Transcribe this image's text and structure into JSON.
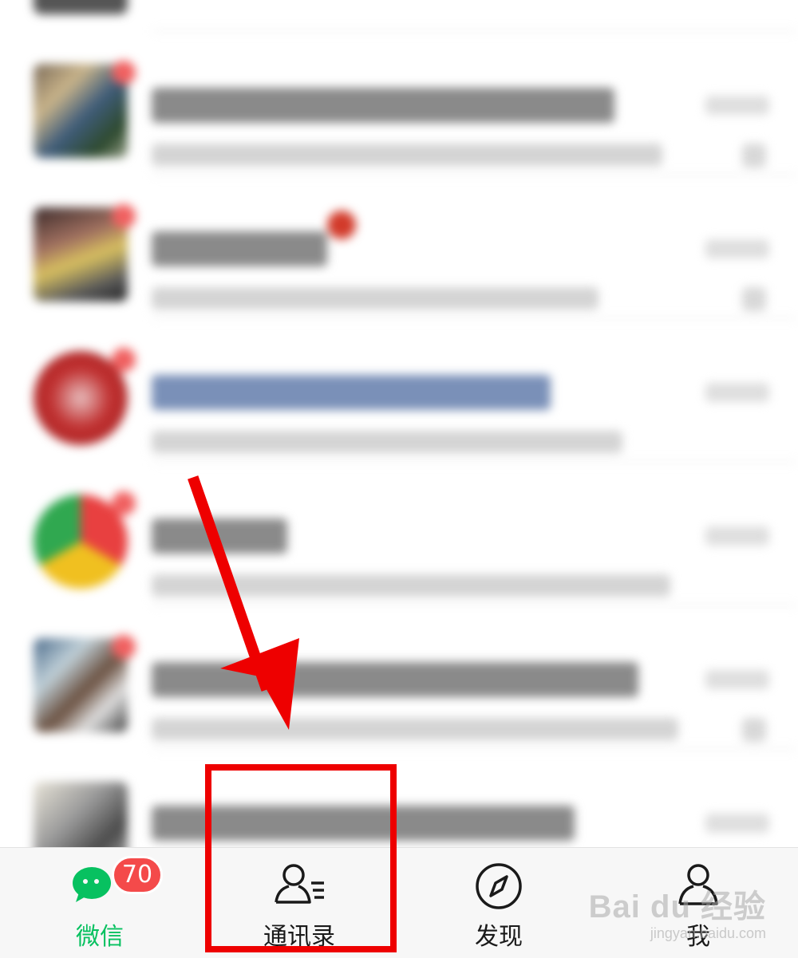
{
  "tabbar": {
    "tabs": [
      {
        "label": "微信",
        "icon": "chat-bubbles-icon",
        "active": true,
        "badge": "70"
      },
      {
        "label": "通讯录",
        "icon": "contacts-icon",
        "active": false
      },
      {
        "label": "发现",
        "icon": "compass-icon",
        "active": false
      },
      {
        "label": "我",
        "icon": "person-icon",
        "active": false
      }
    ]
  },
  "colors": {
    "active": "#07c160",
    "badge": "#f44a4a",
    "annotation": "#ee0000",
    "tabbar_bg": "#f7f7f7"
  },
  "watermark": {
    "main": "Bai du 经验",
    "sub": "jingyan.baidu.com"
  }
}
